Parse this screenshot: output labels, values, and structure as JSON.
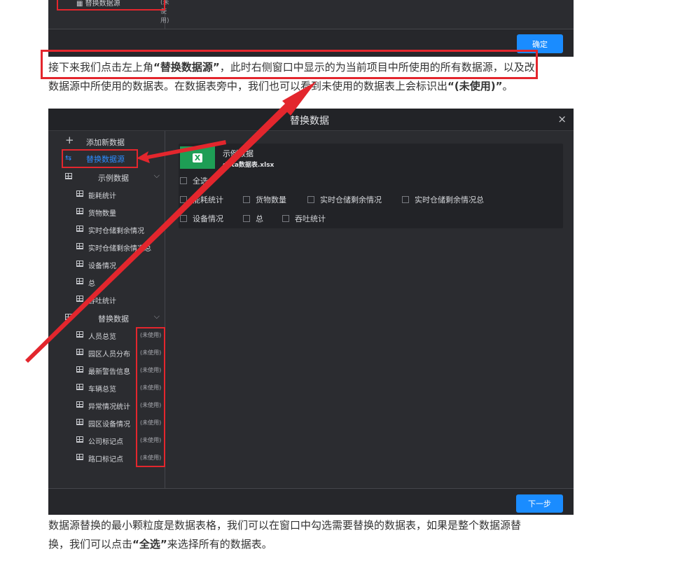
{
  "top_screenshot": {
    "cut_item": "▦ 替换数据源",
    "cut_tag": "(未使用)",
    "confirm_button": "确定"
  },
  "paragraph1": {
    "line1_a": "接下来我们点击左上角",
    "line1_b": "“替换数据源”",
    "line1_c": "，此时右侧窗口中显示的为当前项目中所使用的所有数据源，以及改",
    "line2_a": "数据源中所使用的数据表。在数据表旁中，我们也可以看到未使用的数据表上会标识出",
    "line2_b": "“(未使用)”",
    "line2_c": "。"
  },
  "dialog": {
    "title": "替换数据",
    "close": "×",
    "sidebar": {
      "add_label": "添加新数据",
      "replace_label": "替换数据源",
      "group1": {
        "label": "示例数据",
        "items": [
          "能耗统计",
          "货物数量",
          "实时仓储剩余情况",
          "实时仓储剩余情况总",
          "设备情况",
          "总",
          "吞吐统计"
        ]
      },
      "group2": {
        "label": "替换数据",
        "items": [
          "人员总览",
          "园区人员分布",
          "最新警告信息",
          "车辆总览",
          "异常情况统计",
          "园区设备情况",
          "公司标记点",
          "路口标记点"
        ],
        "tag": "(未使用)"
      }
    },
    "panel": {
      "icon_letter": "X",
      "ds_name": "示例数据",
      "ds_file": "data数据表.xlsx",
      "select_all": "全选",
      "tables": [
        "能耗统计",
        "货物数量",
        "实时仓储剩余情况",
        "实时仓储剩余情况总",
        "设备情况",
        "总",
        "吞吐统计"
      ]
    },
    "next_button": "下一步"
  },
  "paragraph2": {
    "line1": "数据源替换的最小颗粒度是数据表格，我们可以在窗口中勾选需要替换的数据表，如果是整个数据源替",
    "line2_a": "换，我们可以点击",
    "line2_b": "“全选”",
    "line2_c": "来选择所有的数据表。"
  },
  "colors": {
    "annotation_red": "#e3262d",
    "dialog_bg": "#2b2c30",
    "accent_blue": "#1a8cff",
    "excel_green": "#1e9e55"
  }
}
